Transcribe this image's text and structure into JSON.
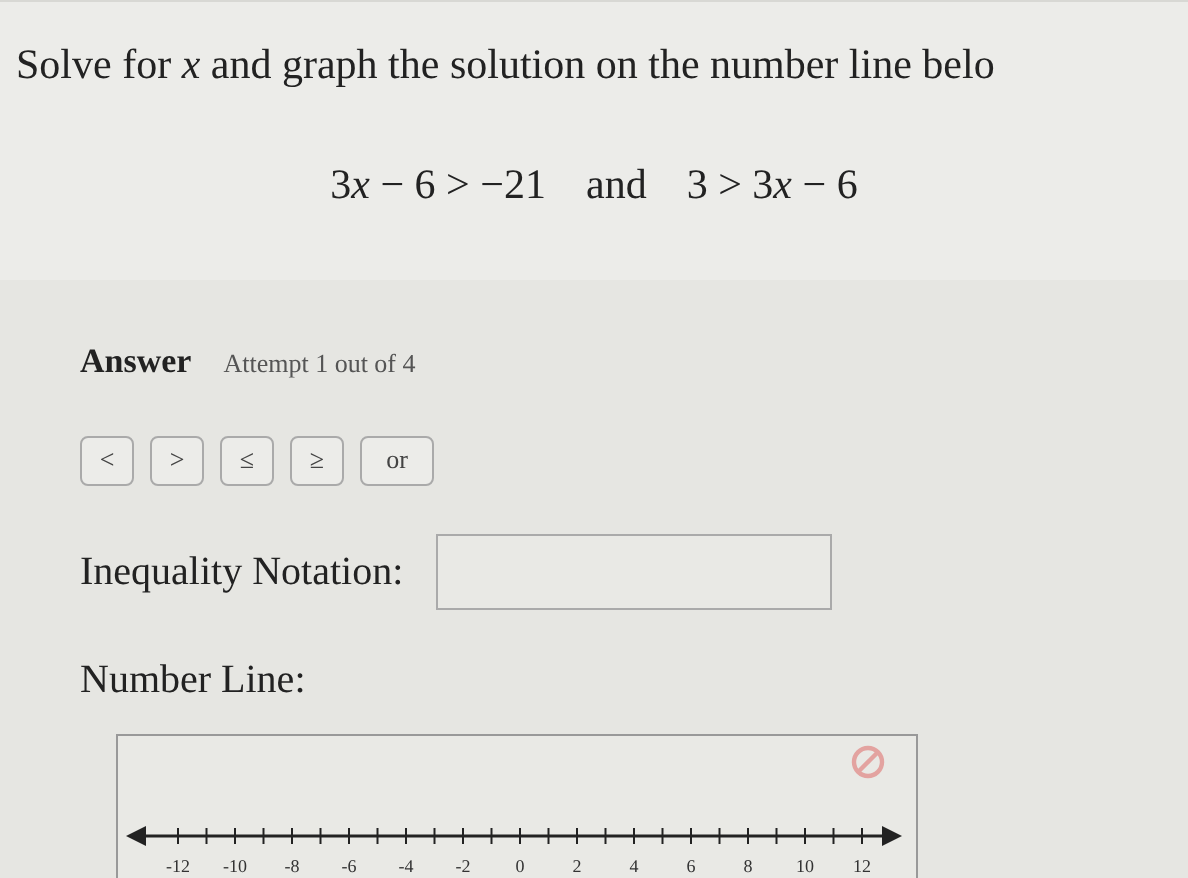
{
  "prompt": "Solve for *x* and graph the solution on the number line belo",
  "equation": {
    "left": [
      {
        "kind": "plain",
        "text": "3"
      },
      {
        "kind": "variable",
        "text": "x"
      },
      {
        "kind": "plain",
        "text": " − 6 > −21"
      }
    ],
    "joiner": "and",
    "right": [
      {
        "kind": "plain",
        "text": "3 > 3"
      },
      {
        "kind": "variable",
        "text": "x"
      },
      {
        "kind": "plain",
        "text": " − 6"
      }
    ]
  },
  "answer": {
    "heading": "Answer",
    "attempt": "Attempt 1 out of 4"
  },
  "symbol_buttons": [
    "<",
    ">",
    "≤",
    "≥",
    "or"
  ],
  "inequality_field": {
    "label": "Inequality Notation:"
  },
  "number_line": {
    "label": "Number Line:",
    "tick_labels": [
      "-12",
      "-10",
      "-8",
      "-6",
      "-4",
      "-2",
      "0",
      "2",
      "4",
      "6",
      "8",
      "10",
      "12"
    ]
  }
}
